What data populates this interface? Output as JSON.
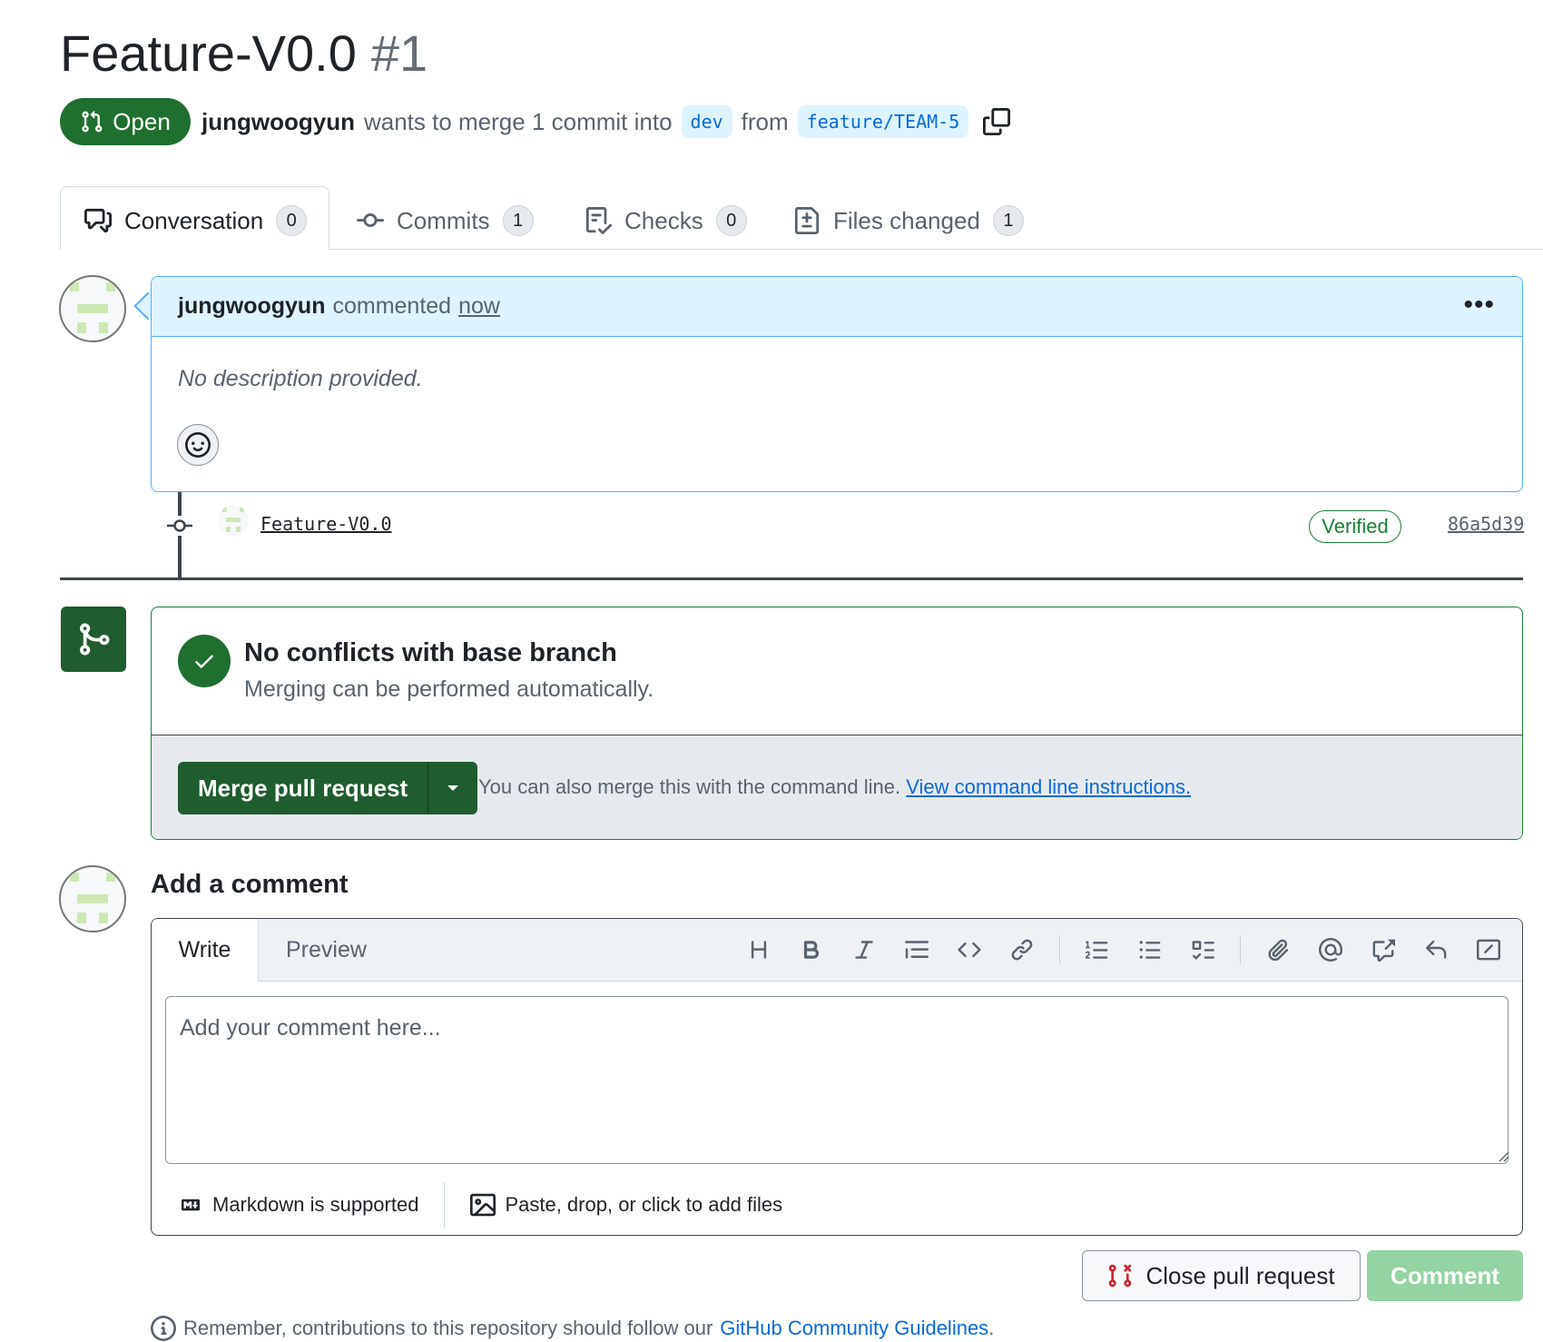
{
  "pr": {
    "title": "Feature-V0.0",
    "number": "#1",
    "state": "Open",
    "author": "jungwoogyun",
    "action": "wants to merge 1 commit into",
    "base_branch": "dev",
    "from_word": "from",
    "head_branch": "feature/TEAM-5"
  },
  "tabs": [
    {
      "label": "Conversation",
      "count": "0",
      "icon": "comment-discussion-icon"
    },
    {
      "label": "Commits",
      "count": "1",
      "icon": "git-commit-icon"
    },
    {
      "label": "Checks",
      "count": "0",
      "icon": "checklist-icon"
    },
    {
      "label": "Files changed",
      "count": "1",
      "icon": "file-diff-icon"
    }
  ],
  "comment": {
    "author": "jungwoogyun",
    "verb": "commented",
    "time": "now",
    "body": "No description provided."
  },
  "commit": {
    "title": "Feature-V0.0",
    "badge": "Verified",
    "sha": "86a5d39"
  },
  "merge": {
    "title": "No conflicts with base branch",
    "subtitle": "Merging can be performed automatically.",
    "button_label": "Merge pull request",
    "hint": "You can also merge this with the command line.",
    "hint_link": "View command line instructions."
  },
  "add_comment": {
    "title": "Add a comment",
    "tab_write": "Write",
    "tab_preview": "Preview",
    "placeholder": "Add your comment here...",
    "markdown_note": "Markdown is supported",
    "files_note": "Paste, drop, or click to add files"
  },
  "toolbar_icons": [
    "heading-icon",
    "bold-icon",
    "italic-icon",
    "quote-icon",
    "code-icon",
    "link-icon",
    "ordered-list-icon",
    "unordered-list-icon",
    "task-list-icon",
    "attach-icon",
    "mention-icon",
    "cross-reference-icon",
    "reply-icon",
    "fullscreen-icon"
  ],
  "actions": {
    "close_label": "Close pull request",
    "comment_label": "Comment"
  },
  "reminder": {
    "text": "Remember, contributions to this repository should follow our",
    "link": "GitHub Community Guidelines",
    "end": "."
  },
  "colors": {
    "open_green": "#1f6f2e",
    "accent_blue": "#0969da",
    "comment_header_bg": "#ddf4ff",
    "comment_btn_disabled": "#94d3a2"
  }
}
